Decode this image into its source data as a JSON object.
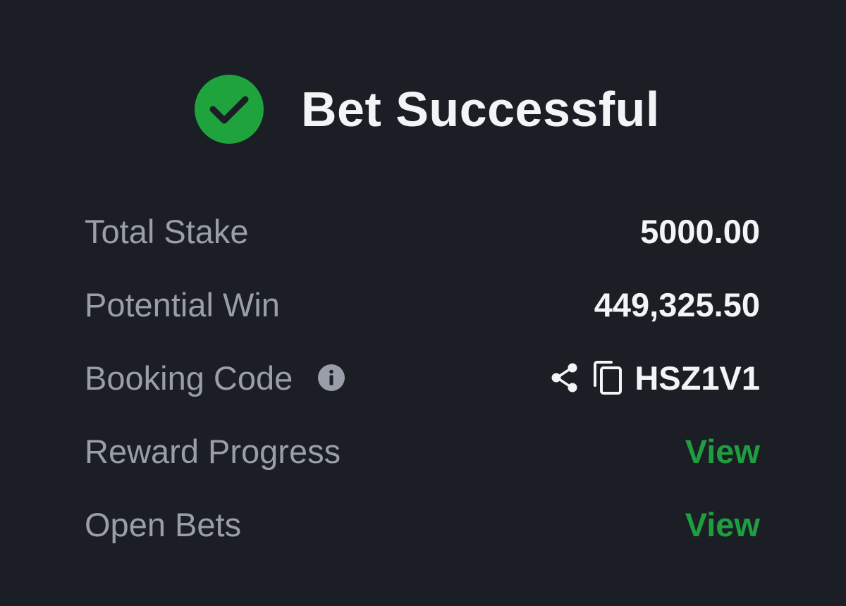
{
  "header": {
    "title": "Bet Successful",
    "icon": "check-circle-icon"
  },
  "rows": [
    {
      "label": "Total Stake",
      "value": "5000.00"
    },
    {
      "label": "Potential Win",
      "value": "449,325.50"
    },
    {
      "label": "Booking Code",
      "value": "HSZ1V1"
    },
    {
      "label": "Reward Progress",
      "value": "View"
    },
    {
      "label": "Open Bets",
      "value": "View"
    }
  ],
  "icons": {
    "info": "info-icon",
    "share": "share-icon",
    "copy": "copy-icon"
  },
  "colors": {
    "background": "#1b1e25",
    "success_green": "#1fa33d",
    "link_green": "#1e9e3e",
    "label_gray": "#9a9ea8",
    "value_white": "#f3f4f6"
  }
}
